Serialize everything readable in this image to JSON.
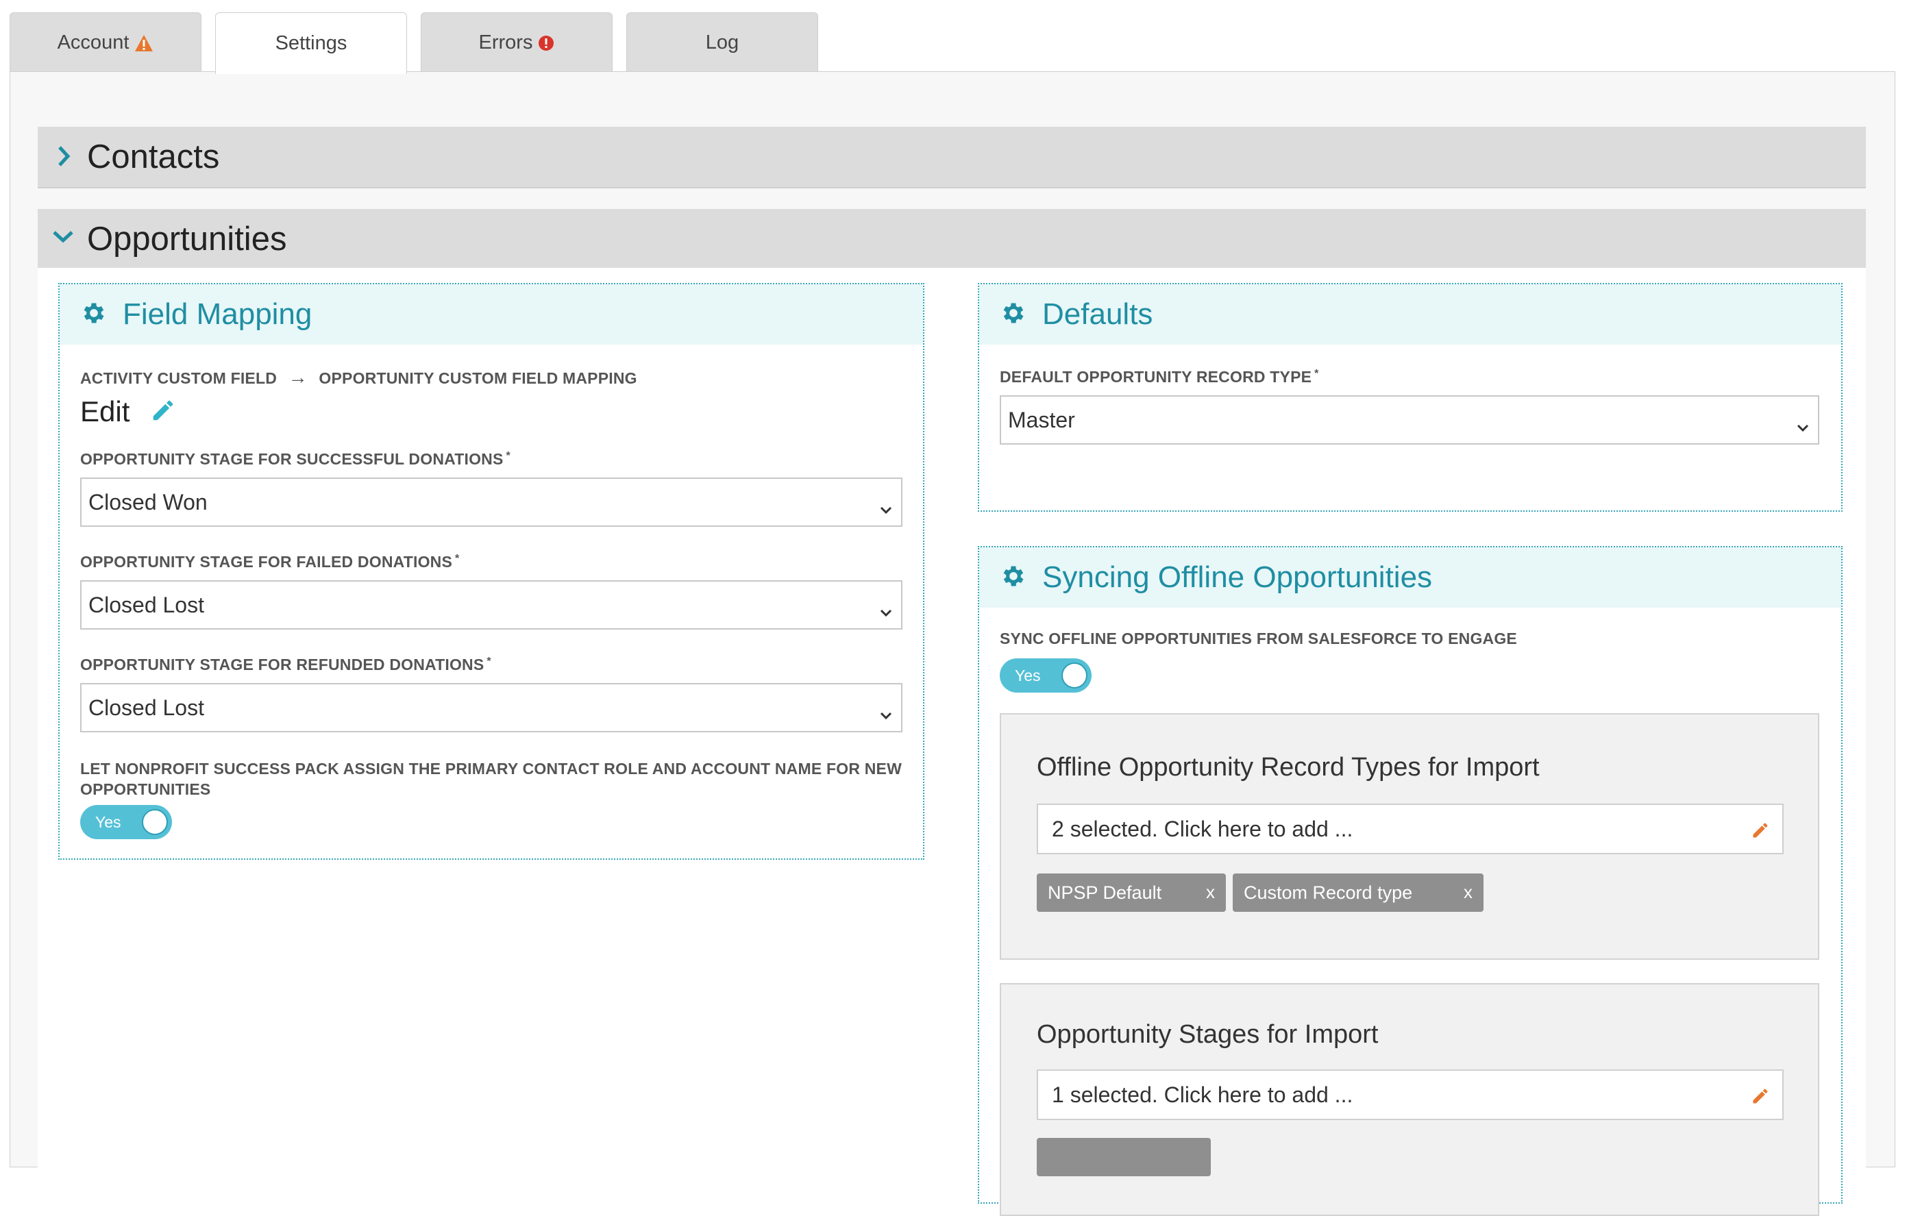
{
  "tabs": [
    {
      "label": "Account",
      "icon": "warning-icon",
      "active": false
    },
    {
      "label": "Settings",
      "icon": "",
      "active": true
    },
    {
      "label": "Errors",
      "icon": "error-icon",
      "active": false
    },
    {
      "label": "Log",
      "icon": "",
      "active": false
    }
  ],
  "colors": {
    "accent": "#1f8ea3",
    "toggle": "#54c0d6",
    "warning": "#e8772e",
    "error": "#d9342b",
    "chip": "#8f8f8f"
  },
  "sections": {
    "contacts": {
      "title": "Contacts",
      "expanded": false
    },
    "opportunities": {
      "title": "Opportunities",
      "expanded": true
    }
  },
  "field_mapping": {
    "title": "Field Mapping",
    "mapping_label_left": "ACTIVITY CUSTOM FIELD",
    "mapping_arrow": "→",
    "mapping_label_right": "OPPORTUNITY CUSTOM FIELD MAPPING",
    "edit_label": "Edit",
    "successful": {
      "label": "OPPORTUNITY STAGE FOR SUCCESSFUL DONATIONS",
      "required": "*",
      "value": "Closed Won"
    },
    "failed": {
      "label": "OPPORTUNITY STAGE FOR FAILED DONATIONS",
      "required": "*",
      "value": "Closed Lost"
    },
    "refunded": {
      "label": "OPPORTUNITY STAGE FOR REFUNDED DONATIONS",
      "required": "*",
      "value": "Closed Lost"
    },
    "npsp_label": "LET NONPROFIT SUCCESS PACK ASSIGN THE PRIMARY CONTACT ROLE AND ACCOUNT NAME FOR NEW OPPORTUNITIES",
    "npsp_toggle": "Yes"
  },
  "defaults": {
    "title": "Defaults",
    "record_type": {
      "label": "DEFAULT OPPORTUNITY RECORD TYPE",
      "required": "*",
      "value": "Master"
    }
  },
  "syncing": {
    "title": "Syncing Offline Opportunities",
    "sync_label": "SYNC OFFLINE OPPORTUNITIES FROM SALESFORCE TO ENGAGE",
    "sync_toggle": "Yes",
    "record_types": {
      "title": "Offline Opportunity Record Types for Import",
      "picker_text": "2 selected. Click here to add ...",
      "chips": [
        {
          "label": "NPSP Default",
          "remove": "x"
        },
        {
          "label": "Custom Record type",
          "remove": "x"
        }
      ]
    },
    "stages": {
      "title": "Opportunity Stages for Import",
      "picker_text": "1 selected. Click here to add ..."
    }
  }
}
